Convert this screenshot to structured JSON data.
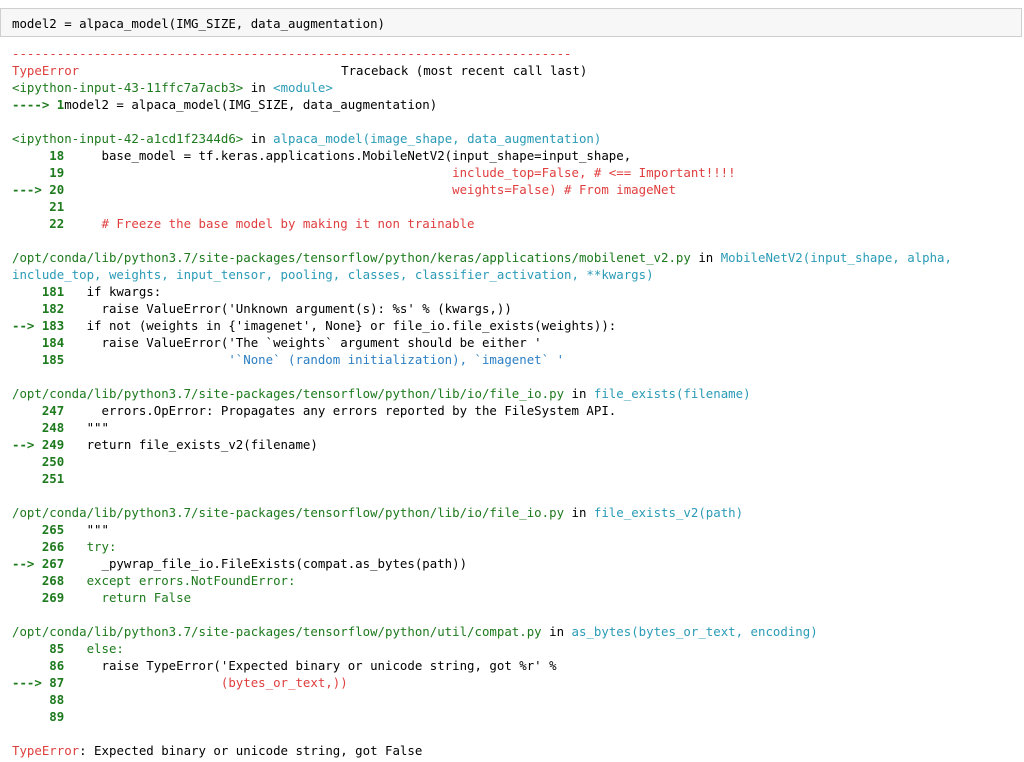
{
  "input_cell": {
    "code": "model2 = alpaca_model(IMG_SIZE, data_augmentation)"
  },
  "traceback": {
    "separator": "---------------------------------------------------------------------------",
    "error_type": "TypeError",
    "header_right": "Traceback (most recent call last)",
    "frames": [
      {
        "file": "<ipython-input-43-11ffc7a7acb3>",
        "in": "in",
        "func": "<module>",
        "lines": [
          {
            "marker": "----> 1",
            "text": "model2 = alpaca_model(IMG_SIZE, data_augmentation)"
          }
        ]
      },
      {
        "file": "<ipython-input-42-a1cd1f2344d6>",
        "in": "in",
        "func": "alpaca_model(image_shape, data_augmentation)",
        "lines": [
          {
            "marker": "     18",
            "text": "     base_model = tf.keras.applications.MobileNetV2(input_shape=input_shape,"
          },
          {
            "marker": "     19",
            "text": "                                                    include_top=False, # <== Important!!!!"
          },
          {
            "marker": "---> 20",
            "text": "                                                    weights=False) # From imageNet"
          },
          {
            "marker": "     21",
            "text": ""
          },
          {
            "marker": "     22",
            "text": "     # Freeze the base model by making it non trainable"
          }
        ]
      },
      {
        "file": "/opt/conda/lib/python3.7/site-packages/tensorflow/python/keras/applications/mobilenet_v2.py",
        "in": "in",
        "func": "MobileNetV2(input_shape, alpha,",
        "func_cont": "include_top, weights, input_tensor, pooling, classes, classifier_activation, **kwargs)",
        "lines": [
          {
            "marker": "    181",
            "text": "   if kwargs:"
          },
          {
            "marker": "    182",
            "text": "     raise ValueError('Unknown argument(s): %s' % (kwargs,))"
          },
          {
            "marker": "--> 183",
            "text": "   if not (weights in {'imagenet', None} or file_io.file_exists(weights)):"
          },
          {
            "marker": "    184",
            "text": "     raise ValueError('The `weights` argument should be either '"
          },
          {
            "marker": "    185",
            "text": "                      '`None` (random initialization), `imagenet` '"
          }
        ]
      },
      {
        "file": "/opt/conda/lib/python3.7/site-packages/tensorflow/python/lib/io/file_io.py",
        "in": "in",
        "func": "file_exists(filename)",
        "lines": [
          {
            "marker": "    247",
            "text": "     errors.OpError: Propagates any errors reported by the FileSystem API."
          },
          {
            "marker": "    248",
            "text": "   \"\"\""
          },
          {
            "marker": "--> 249",
            "text": "   return file_exists_v2(filename)"
          },
          {
            "marker": "    250",
            "text": ""
          },
          {
            "marker": "    251",
            "text": ""
          }
        ]
      },
      {
        "file": "/opt/conda/lib/python3.7/site-packages/tensorflow/python/lib/io/file_io.py",
        "in": "in",
        "func": "file_exists_v2(path)",
        "lines": [
          {
            "marker": "    265",
            "text": "   \"\"\""
          },
          {
            "marker": "    266",
            "text": "   try:"
          },
          {
            "marker": "--> 267",
            "text": "     _pywrap_file_io.FileExists(compat.as_bytes(path))"
          },
          {
            "marker": "    268",
            "text": "   except errors.NotFoundError:"
          },
          {
            "marker": "    269",
            "text": "     return False"
          }
        ]
      },
      {
        "file": "/opt/conda/lib/python3.7/site-packages/tensorflow/python/util/compat.py",
        "in": "in",
        "func": "as_bytes(bytes_or_text, encoding)",
        "lines": [
          {
            "marker": "     85",
            "text": "   else:"
          },
          {
            "marker": "     86",
            "text": "     raise TypeError('Expected binary or unicode string, got %r' %"
          },
          {
            "marker": "---> 87",
            "text": "                     (bytes_or_text,))"
          },
          {
            "marker": "     88",
            "text": ""
          },
          {
            "marker": "     89",
            "text": ""
          }
        ]
      }
    ],
    "final_error_type": "TypeError",
    "final_message": ": Expected binary or unicode string, got False"
  },
  "colors": {
    "error": "#e03e3e",
    "green": "#1d7a1d",
    "blue": "#2d7fc4",
    "cyan": "#2a9bb6"
  }
}
